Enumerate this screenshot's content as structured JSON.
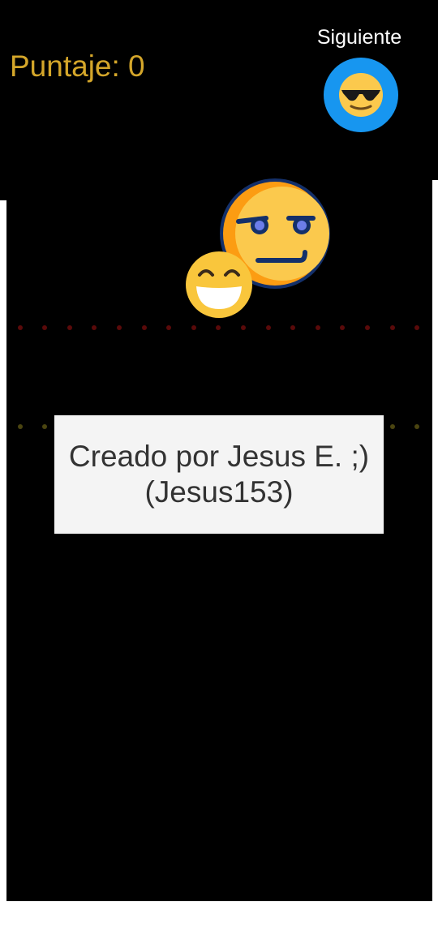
{
  "hud": {
    "score_label": "Puntaje: 0",
    "next_label": "Siguiente",
    "next_icon": "sunglasses-emoji-icon"
  },
  "game": {
    "emojis": [
      {
        "name": "smirking-face-emoji",
        "color": "#fbc94d"
      },
      {
        "name": "grinning-face-emoji",
        "color": "#f9c63c"
      }
    ],
    "lines": [
      {
        "name": "red-dotted-line",
        "color": "#5a0a0a"
      },
      {
        "name": "yellow-dotted-line",
        "color": "#4a4410"
      }
    ]
  },
  "credit": {
    "line1": "Creado por Jesus E. ;)",
    "line2": "(Jesus153)"
  },
  "colors": {
    "background": "#000000",
    "score_text": "#d4a62a",
    "next_button": "#1796f0",
    "credit_box": "#f4f4f4",
    "credit_text": "#333333"
  }
}
